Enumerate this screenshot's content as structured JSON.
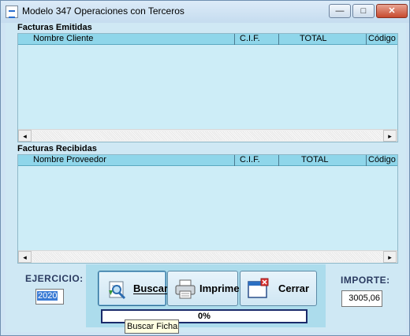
{
  "window": {
    "title": "Modelo 347 Operaciones con Terceros",
    "controls": {
      "minimize": "—",
      "maximize": "□",
      "close": "✕"
    }
  },
  "emitidas": {
    "label": "Facturas Emitidas",
    "columns": [
      "Nombre Cliente",
      "C.I.F.",
      "TOTAL",
      "Código"
    ],
    "rows": []
  },
  "recibidas": {
    "label": "Facturas Recibidas",
    "columns": [
      "Nombre Proveedor",
      "C.I.F.",
      "TOTAL",
      "Código"
    ],
    "rows": []
  },
  "scroll": {
    "left": "◂",
    "right": "▸"
  },
  "ejercicio": {
    "label": "EJERCICIO:",
    "value": "2020"
  },
  "importe": {
    "label": "IMPORTE:",
    "value": "3005,06"
  },
  "buttons": {
    "buscar": "Buscar",
    "imprime": "Imprime",
    "cerrar": "Cerrar"
  },
  "progress": {
    "label": "0%",
    "fraction": 0
  },
  "tooltip": "Buscar Ficha",
  "colors": {
    "grid_bg": "#cdedf7",
    "header_bg": "#8fd6ea",
    "panel_bg": "#acdcec",
    "label_color": "#2a3a60"
  },
  "icons": {
    "app": "app-window-icon",
    "buscar": "search-document-icon",
    "imprime": "printer-icon",
    "cerrar": "close-window-icon"
  }
}
